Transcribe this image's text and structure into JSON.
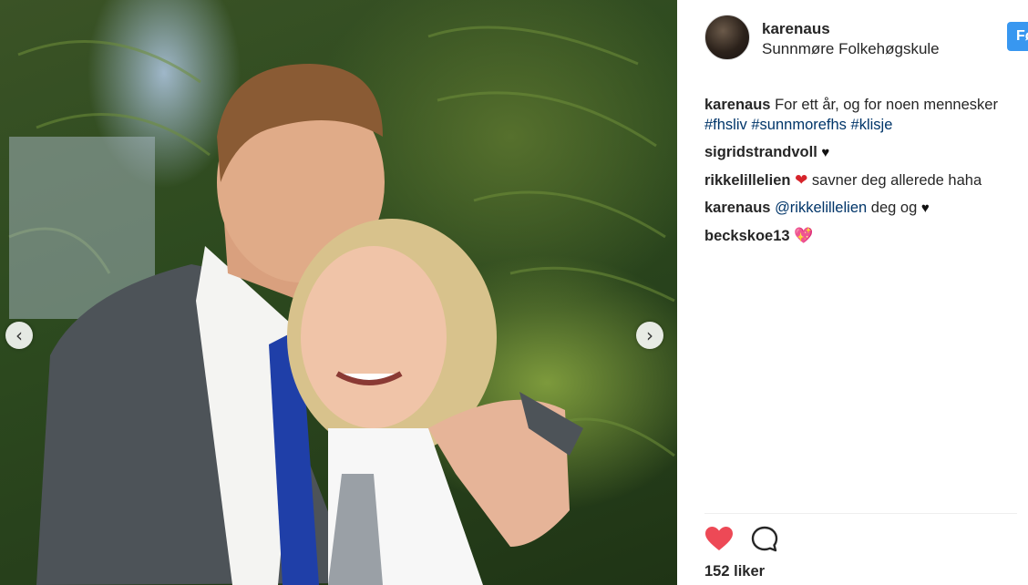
{
  "post": {
    "username": "karenaus",
    "location": "Sunnmøre Folkehøgskule",
    "follow_label": "Følg",
    "likes_text": "152 liker"
  },
  "comments": [
    {
      "user": "karenaus",
      "text": "For ett år, og for noen mennesker",
      "tags": [
        "#fhsliv",
        "#sunnmorefhs",
        "#klisje"
      ]
    },
    {
      "user": "sigridstrandvoll",
      "text": "",
      "emoji": "♥"
    },
    {
      "user": "rikkelillelien",
      "emoji": "❤",
      "text": "savner deg allerede haha"
    },
    {
      "user": "karenaus",
      "mention": "@rikkelillelien",
      "text": "deg og",
      "emoji": "♥"
    },
    {
      "user": "beckskoe13",
      "emoji": "💖"
    }
  ],
  "icons": {
    "prev": "chevron-left-icon",
    "next": "chevron-right-icon",
    "like": "heart-icon",
    "comment": "comment-bubble-icon"
  },
  "colors": {
    "follow_button": "#3897f0",
    "like_heart": "#ed4956",
    "hashtag": "#003569"
  }
}
